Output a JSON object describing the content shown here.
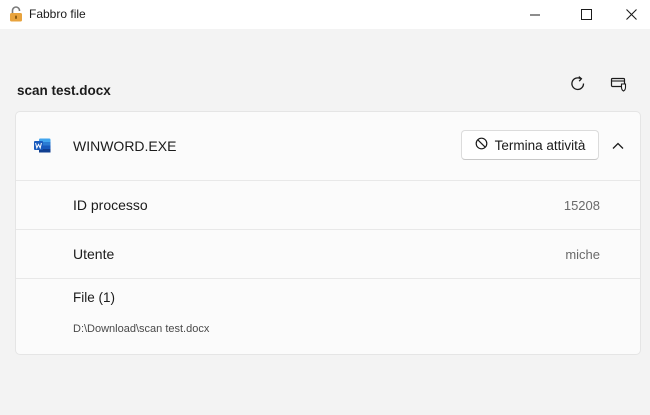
{
  "window": {
    "title": "Fabbro file",
    "app_icon": "padlock-icon",
    "controls": [
      "minimize-icon",
      "maximize-icon",
      "close-icon"
    ]
  },
  "header": {
    "file_name": "scan test.docx",
    "actions": [
      "refresh-icon",
      "settings-shield-icon"
    ]
  },
  "process": {
    "icon": "word-icon",
    "name": "WINWORD.EXE",
    "kill_label": "Termina attività",
    "kill_icon": "block-icon",
    "collapse_icon": "chevron-up-icon",
    "details": [
      {
        "label": "ID processo",
        "value": "15208"
      },
      {
        "label": "Utente",
        "value": "miche"
      }
    ],
    "files_title": "File (1)",
    "files": [
      "D:\\Download\\scan test.docx"
    ]
  },
  "colors": {
    "background": "#f3f3f3",
    "card": "#fbfbfb",
    "word_blue": "#185abd",
    "lock_orange": "#e8a33d"
  }
}
